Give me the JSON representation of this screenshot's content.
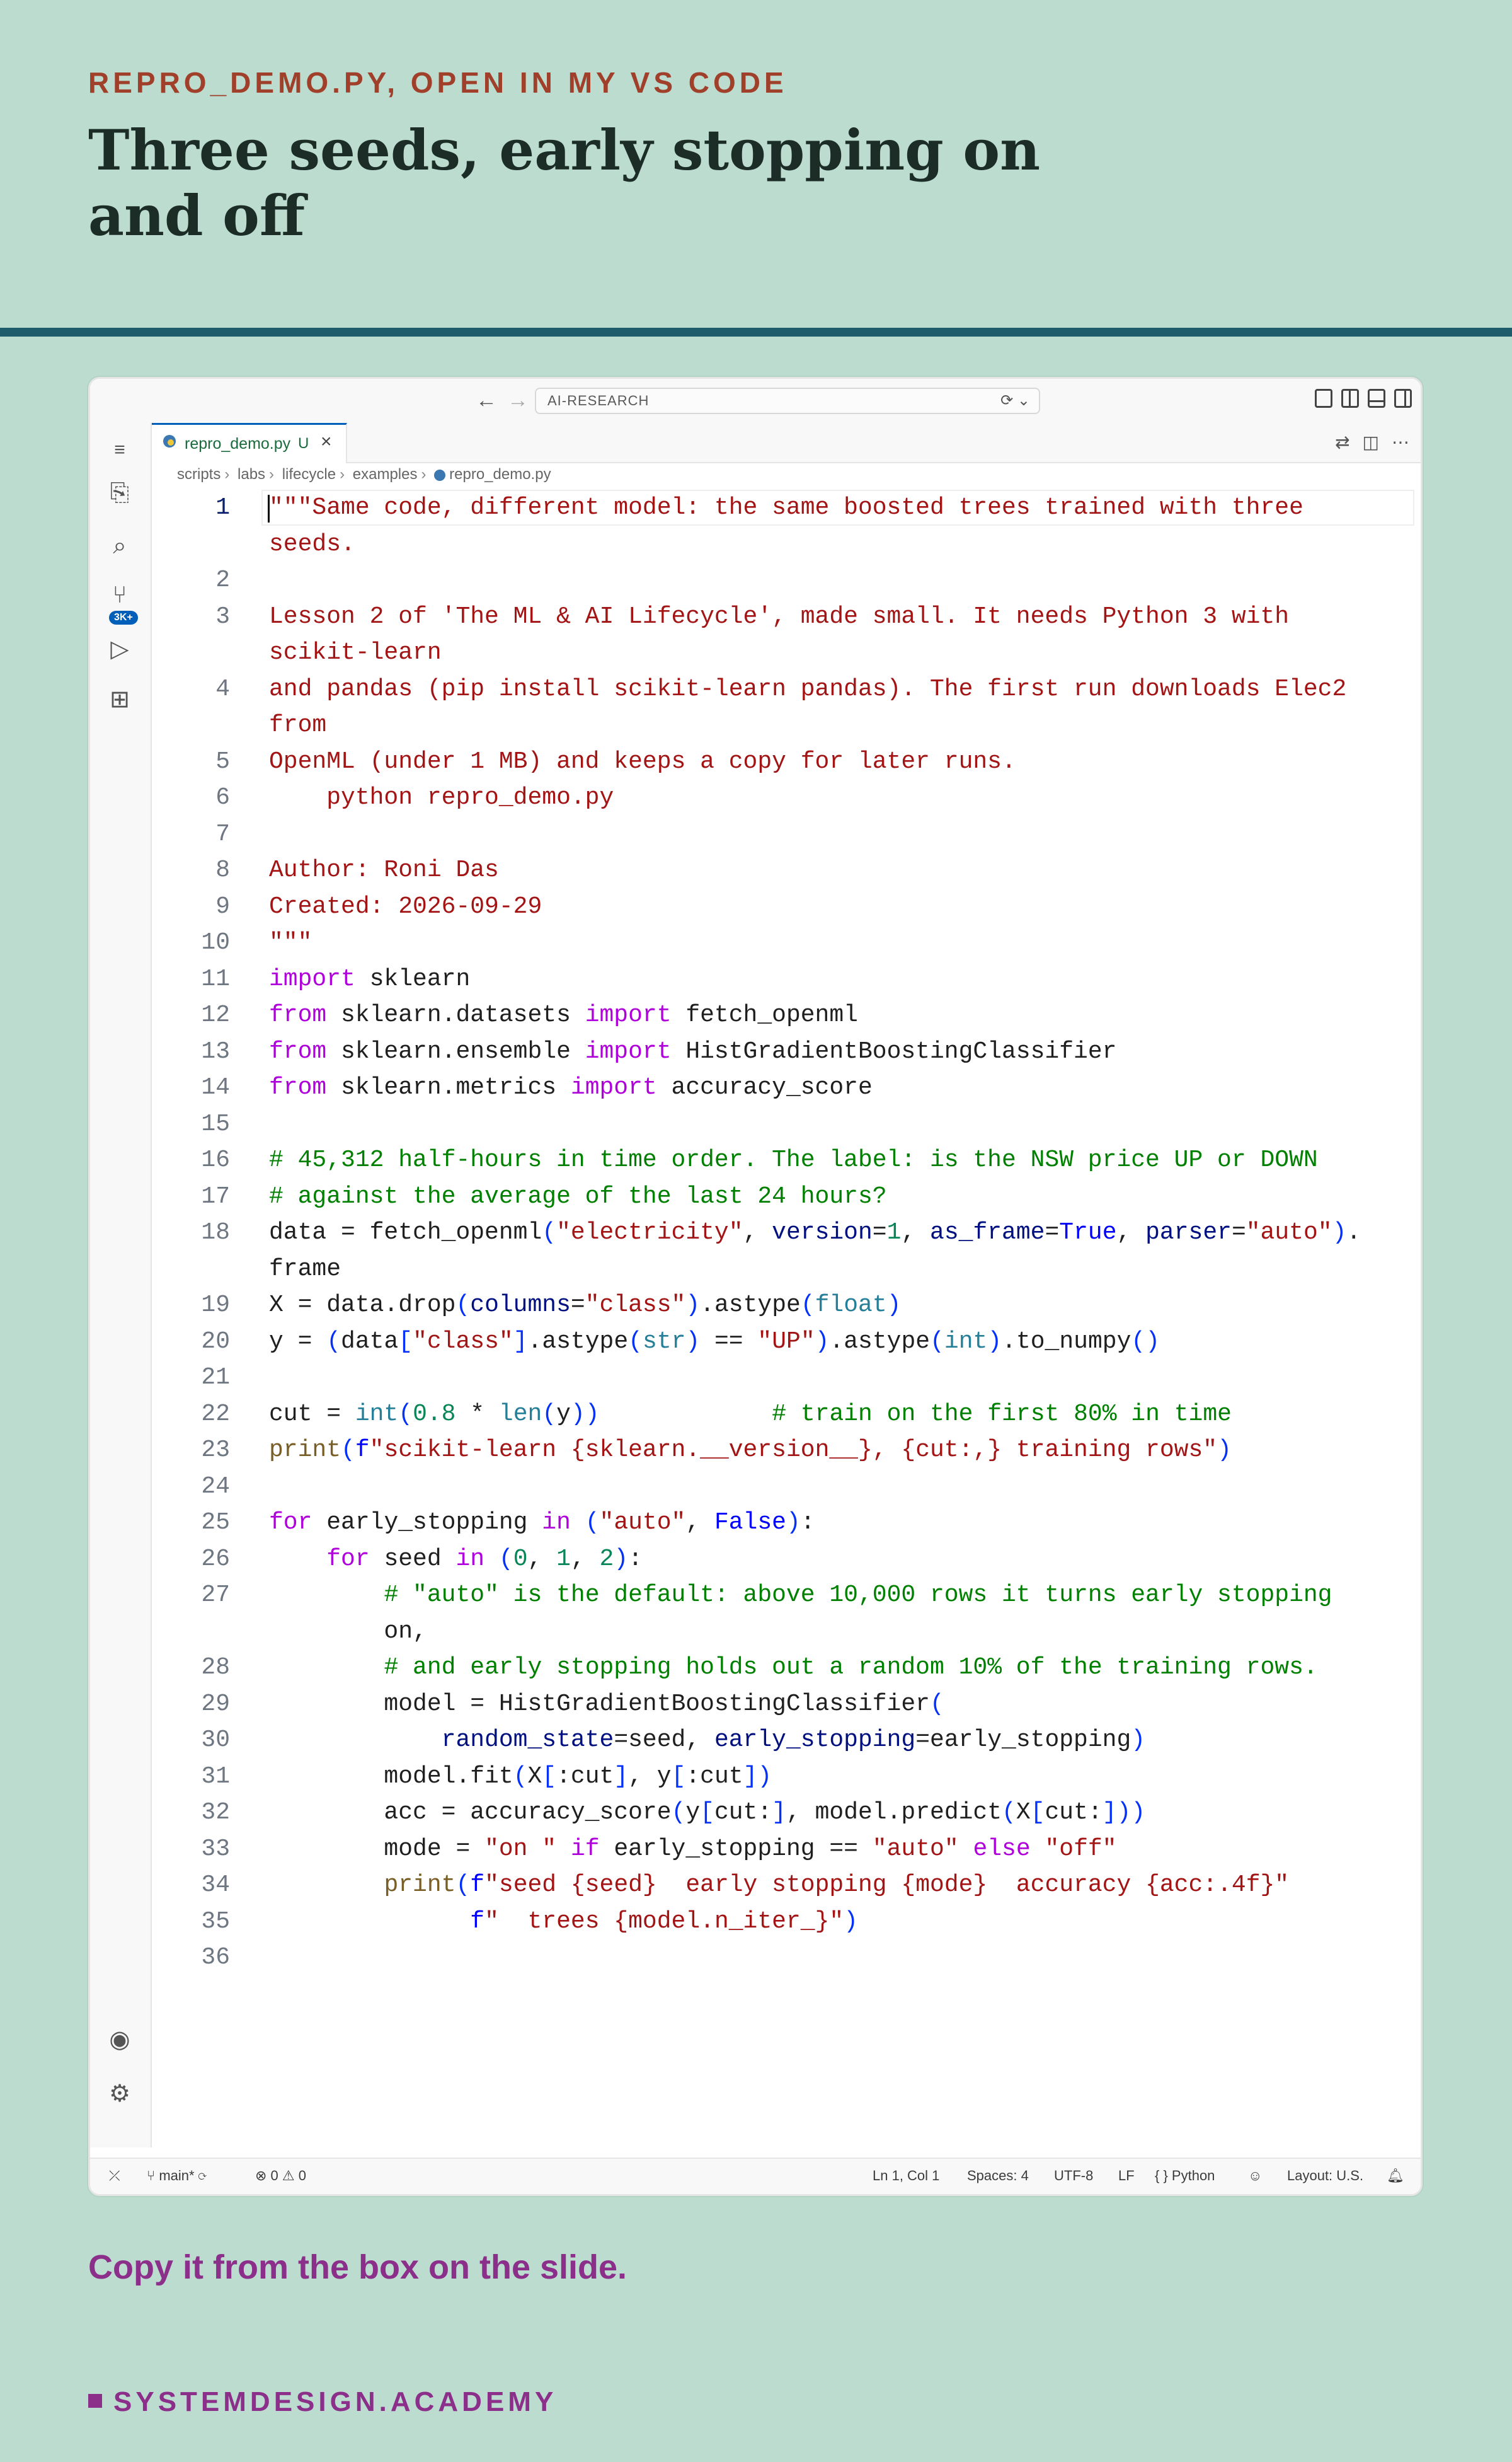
{
  "slide": {
    "kicker": "REPRO_DEMO.PY, OPEN IN MY VS CODE",
    "title": "Three seeds, early stopping on and off",
    "footer_note": "Copy it from the box on the slide.",
    "brand": "SYSTEMDESIGN.ACADEMY"
  },
  "titlebar": {
    "search_text": "AI-RESEARCH"
  },
  "activity": {
    "scm_badge": "3K+"
  },
  "tab": {
    "label": "repro_demo.py",
    "status": "U",
    "close": "×"
  },
  "breadcrumb": [
    "scripts",
    "labs",
    "lifecycle",
    "examples",
    "repro_demo.py"
  ],
  "code_lines": [
    "\"\"\"Same code, different model: the same boosted trees trained with three",
    "seeds.",
    "",
    "Lesson 2 of 'The ML & AI Lifecycle', made small. It needs Python 3 with",
    "scikit-learn",
    "and pandas (pip install scikit-learn pandas). The first run downloads Elec2",
    "from",
    "OpenML (under 1 MB) and keeps a copy for later runs.",
    "    python repro_demo.py",
    "",
    "Author: Roni Das",
    "Created: 2026-09-29",
    "\"\"\"",
    "import sklearn",
    "from sklearn.datasets import fetch_openml",
    "from sklearn.ensemble import HistGradientBoostingClassifier",
    "from sklearn.metrics import accuracy_score",
    "",
    "# 45,312 half-hours in time order. The label: is the NSW price UP or DOWN",
    "# against the average of the last 24 hours?",
    "data = fetch_openml(\"electricity\", version=1, as_frame=True, parser=\"auto\").",
    "frame",
    "X = data.drop(columns=\"class\").astype(float)",
    "y = (data[\"class\"].astype(str) == \"UP\").astype(int).to_numpy()",
    "",
    "cut = int(0.8 * len(y))            # train on the first 80% in time",
    "print(f\"scikit-learn {sklearn.__version__}, {cut:,} training rows\")",
    "",
    "for early_stopping in (\"auto\", False):",
    "    for seed in (0, 1, 2):",
    "        # \"auto\" is the default: above 10,000 rows it turns early stopping",
    "        on,",
    "        # and early stopping holds out a random 10% of the training rows.",
    "        model = HistGradientBoostingClassifier(",
    "            random_state=seed, early_stopping=early_stopping)",
    "        model.fit(X[:cut], y[:cut])",
    "        acc = accuracy_score(y[cut:], model.predict(X[cut:]))",
    "        mode = \"on \" if early_stopping == \"auto\" else \"off\"",
    "        print(f\"seed {seed}  early stopping {mode}  accuracy {acc:.4f}\"",
    "              f\"  trees {model.n_iter_}\")",
    ""
  ],
  "line_numbers": [
    "1",
    "",
    "2",
    "3",
    "",
    "4",
    "",
    "5",
    "6",
    "7",
    "8",
    "9",
    "10",
    "11",
    "12",
    "13",
    "14",
    "15",
    "16",
    "17",
    "18",
    "",
    "19",
    "20",
    "21",
    "22",
    "23",
    "24",
    "25",
    "26",
    "27",
    "",
    "28",
    "29",
    "30",
    "31",
    "32",
    "33",
    "34",
    "35",
    "36"
  ],
  "status": {
    "branch": "main*",
    "problems": "0",
    "warnings": "0",
    "position": "Ln 1, Col 1",
    "spaces": "Spaces: 4",
    "encoding": "UTF-8",
    "eol": "LF",
    "language": "Python",
    "layout": "Layout: U.S."
  }
}
